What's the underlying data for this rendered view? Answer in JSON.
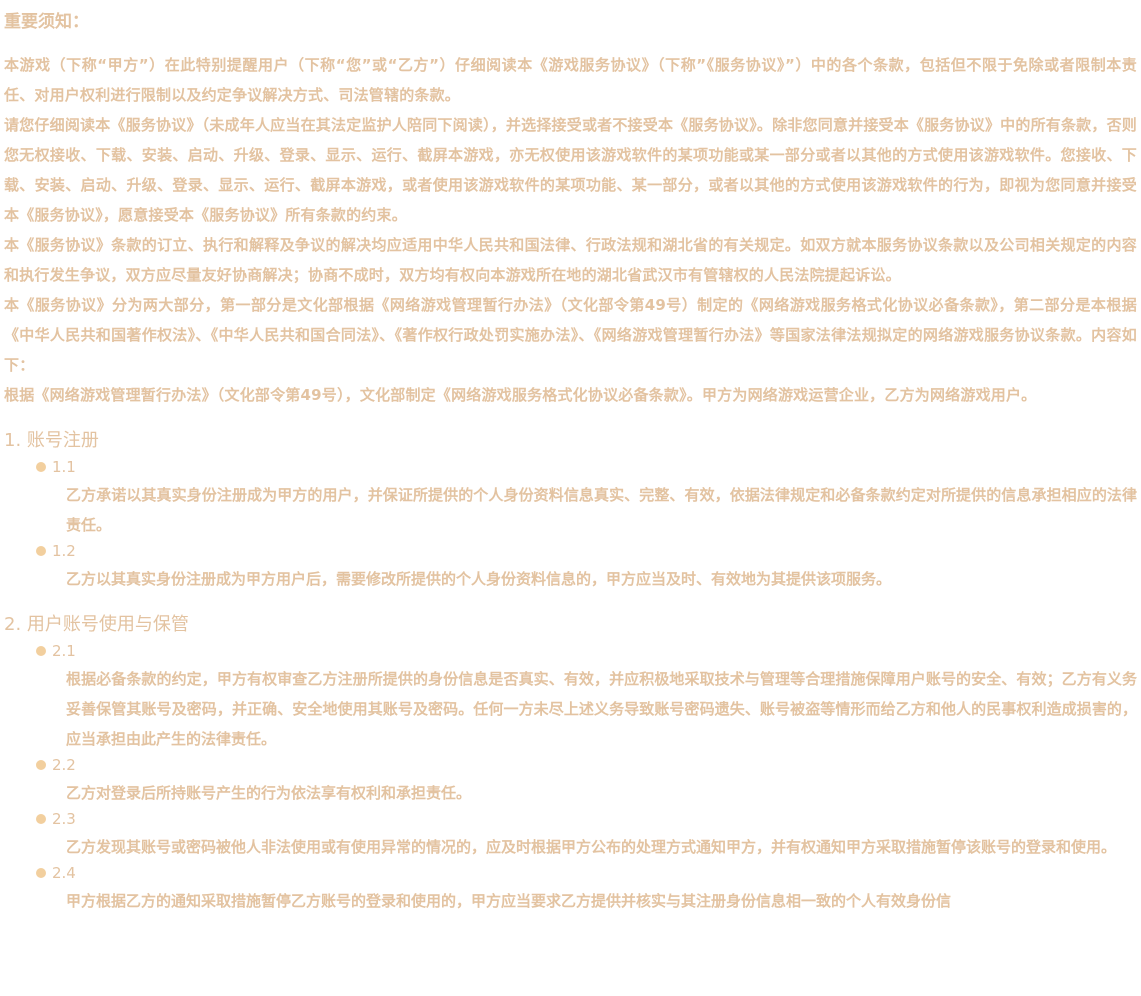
{
  "notice": {
    "title": "重要须知：",
    "paragraphs": [
      "本游戏（下称“甲方”）在此特别提醒用户（下称“您”或“乙方”）仔细阅读本《游戏服务协议》（下称”《服务协议》”）中的各个条款，包括但不限于免除或者限制本责任、对用户权利进行限制以及约定争议解决方式、司法管辖的条款。",
      "请您仔细阅读本《服务协议》（未成年人应当在其法定监护人陪同下阅读），并选择接受或者不接受本《服务协议》。除非您同意并接受本《服务协议》中的所有条款，否则您无权接收、下载、安装、启动、升级、登录、显示、运行、截屏本游戏，亦无权使用该游戏软件的某项功能或某一部分或者以其他的方式使用该游戏软件。您接收、下载、安装、启动、升级、登录、显示、运行、截屏本游戏，或者使用该游戏软件的某项功能、某一部分，或者以其他的方式使用该游戏软件的行为，即视为您同意并接受本《服务协议》，愿意接受本《服务协议》所有条款的约束。",
      "本《服务协议》条款的订立、执行和解释及争议的解决均应适用中华人民共和国法律、行政法规和湖北省的有关规定。如双方就本服务协议条款以及公司相关规定的内容和执行发生争议，双方应尽量友好协商解决；协商不成时，双方均有权向本游戏所在地的湖北省武汉市有管辖权的人民法院提起诉讼。",
      "本《服务协议》分为两大部分，第一部分是文化部根据《网络游戏管理暂行办法》（文化部令第49号）制定的《网络游戏服务格式化协议必备条款》，第二部分是本根据《中华人民共和国著作权法》、《中华人民共和国合同法》、《著作权行政处罚实施办法》、《网络游戏管理暂行办法》等国家法律法规拟定的网络游戏服务协议条款。内容如下：",
      "根据《网络游戏管理暂行办法》（文化部令第49号），文化部制定《网络游戏服务格式化协议必备条款》。甲方为网络游戏运营企业，乙方为网络游戏用户。"
    ]
  },
  "sections": [
    {
      "title": "1. 账号注册",
      "items": [
        {
          "num": "1.1",
          "text": "乙方承诺以其真实身份注册成为甲方的用户，并保证所提供的个人身份资料信息真实、完整、有效，依据法律规定和必备条款约定对所提供的信息承担相应的法律责任。"
        },
        {
          "num": "1.2",
          "text": "乙方以其真实身份注册成为甲方用户后，需要修改所提供的个人身份资料信息的，甲方应当及时、有效地为其提供该项服务。"
        }
      ]
    },
    {
      "title": "2. 用户账号使用与保管",
      "items": [
        {
          "num": "2.1",
          "text": "根据必备条款的约定，甲方有权审查乙方注册所提供的身份信息是否真实、有效，并应积极地采取技术与管理等合理措施保障用户账号的安全、有效；乙方有义务妥善保管其账号及密码，并正确、安全地使用其账号及密码。任何一方未尽上述义务导致账号密码遗失、账号被盗等情形而给乙方和他人的民事权利造成损害的，应当承担由此产生的法律责任。"
        },
        {
          "num": "2.2",
          "text": "乙方对登录后所持账号产生的行为依法享有权利和承担责任。"
        },
        {
          "num": "2.3",
          "text": "乙方发现其账号或密码被他人非法使用或有使用异常的情况的，应及时根据甲方公布的处理方式通知甲方，并有权通知甲方采取措施暂停该账号的登录和使用。"
        },
        {
          "num": "2.4",
          "text": "甲方根据乙方的通知采取措施暂停乙方账号的登录和使用的，甲方应当要求乙方提供并核实与其注册身份信息相一致的个人有效身份信"
        }
      ]
    }
  ],
  "colors": {
    "text": "#e3c3a1",
    "bullet": "#f2cf9e",
    "background": "#ffffff"
  }
}
